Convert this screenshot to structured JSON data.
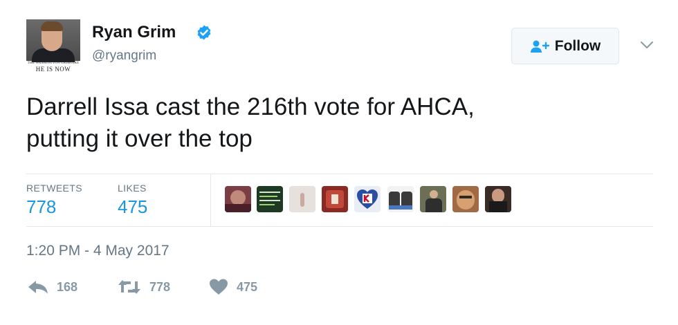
{
  "author": {
    "name": "Ryan Grim",
    "handle": "@ryangrim",
    "avatar_caption_small": "THE WASHINGTON GRIMOIRE",
    "avatar_caption_large": "HE IS NOW",
    "verified_color": "#1da1f2"
  },
  "follow": {
    "label": "Follow"
  },
  "tweet": {
    "lines": [
      "Darrell Issa cast the 216th vote for AHCA,",
      "putting it over the top"
    ]
  },
  "stats": {
    "retweets_label": "RETWEETS",
    "retweets_value": "778",
    "likes_label": "LIKES",
    "likes_value": "475"
  },
  "likers": [
    {
      "name": "liker-1",
      "color": "#7a3e44"
    },
    {
      "name": "liker-2",
      "color": "#1f3a24"
    },
    {
      "name": "liker-3",
      "color": "#d9d4cf"
    },
    {
      "name": "liker-4",
      "color": "#8a2a25"
    },
    {
      "name": "liker-5",
      "color": "#2b4ea0"
    },
    {
      "name": "liker-6",
      "color": "#3a3a3a"
    },
    {
      "name": "liker-7",
      "color": "#6a6f55"
    },
    {
      "name": "liker-8",
      "color": "#a06a45"
    },
    {
      "name": "liker-9",
      "color": "#3b2b25"
    }
  ],
  "timestamp": "1:20 PM - 4 May 2017",
  "actions": {
    "reply_count": "168",
    "retweet_count": "778",
    "like_count": "475"
  },
  "colors": {
    "text": "#14171a",
    "muted": "#657786",
    "accent": "#1b95e0",
    "action_gray": "#8899a6",
    "border": "#e1e8ed"
  },
  "icons": [
    "verified-icon",
    "follow-user-icon",
    "chevron-down-icon",
    "reply-icon",
    "retweet-icon",
    "heart-icon"
  ]
}
